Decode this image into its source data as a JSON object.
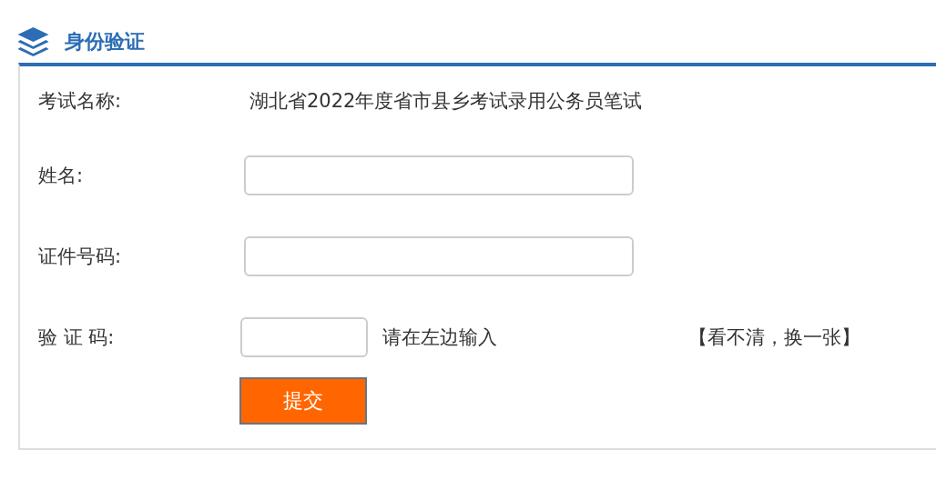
{
  "header": {
    "title": "身份验证"
  },
  "exam": {
    "label": "考试名称:",
    "value": "湖北省2022年度省市县乡考试录用公务员笔试"
  },
  "fields": [
    {
      "label": "姓名:"
    },
    {
      "label": "证件号码:"
    }
  ],
  "captcha": {
    "label": "验 证 码:",
    "hint": "请在左边输入",
    "refresh_link": "【看不清，换一张】"
  },
  "submit_button": "提交"
}
